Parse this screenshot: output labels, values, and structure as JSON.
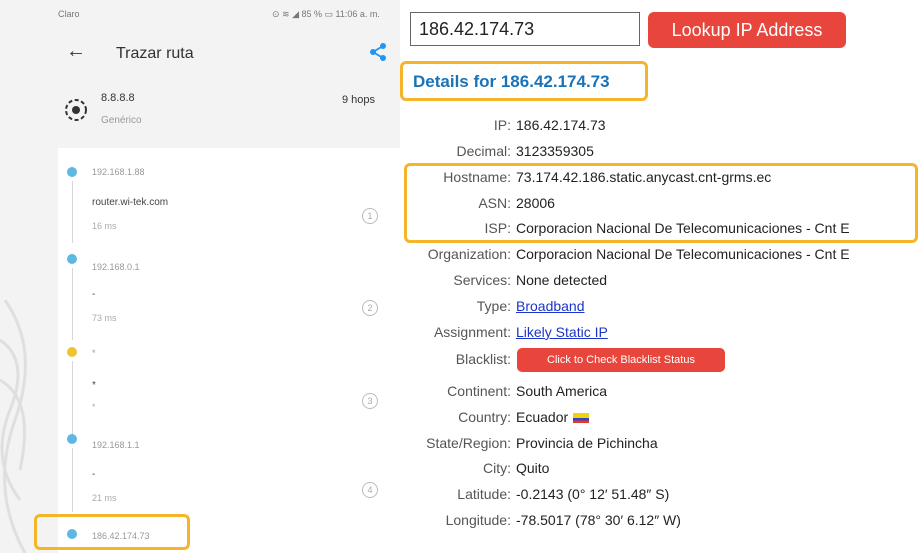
{
  "phone": {
    "status": {
      "carrier": "Claro",
      "right": "⊙ ≋ ◢ 85 % ▭ 11:06 a. m."
    },
    "title": "Trazar ruta",
    "target": {
      "host": "8.8.8.8",
      "sub": "Genérico",
      "hops": "9 hops"
    },
    "hops": [
      {
        "ip": "192.168.1.88",
        "name": "router.wi-tek.com",
        "ms": "16 ms",
        "num": "1",
        "color": "#5db8e2"
      },
      {
        "ip": "192.168.0.1",
        "name": "-",
        "ms": "73 ms",
        "num": "2",
        "color": "#5db8e2"
      },
      {
        "ip": "*",
        "name": "*",
        "ms": "*",
        "num": "3",
        "color": "#f1c232"
      },
      {
        "ip": "192.168.1.1",
        "name": "-",
        "ms": "21 ms",
        "num": "4",
        "color": "#5db8e2"
      },
      {
        "ip": "186.42.174.73",
        "color": "#5db8e2"
      }
    ]
  },
  "lookup": {
    "ip_value": "186.42.174.73",
    "button": "Lookup IP Address",
    "details_title": "Details for 186.42.174.73",
    "rows": [
      {
        "label": "IP:",
        "value": "186.42.174.73"
      },
      {
        "label": "Decimal:",
        "value": "3123359305"
      },
      {
        "label": "Hostname:",
        "value": "73.174.42.186.static.anycast.cnt-grms.ec"
      },
      {
        "label": "ASN:",
        "value": "28006"
      },
      {
        "label": "ISP:",
        "value": "Corporacion Nacional De Telecomunicaciones - Cnt E"
      },
      {
        "label": "Organization:",
        "value": "Corporacion Nacional De Telecomunicaciones - Cnt E"
      },
      {
        "label": "Services:",
        "value": "None detected"
      },
      {
        "label": "Type:",
        "value": "Broadband",
        "link": true
      },
      {
        "label": "Assignment:",
        "value": "Likely Static IP",
        "link": true
      },
      {
        "label": "Blacklist:",
        "button": "Click to Check Blacklist Status"
      },
      {
        "label": "Continent:",
        "value": "South America"
      },
      {
        "label": "Country:",
        "value": "Ecuador",
        "flag": true
      },
      {
        "label": "State/Region:",
        "value": "Provincia de Pichincha"
      },
      {
        "label": "City:",
        "value": "Quito"
      },
      {
        "label": "Latitude:",
        "value": "-0.2143  (0° 12′ 51.48″ S)"
      },
      {
        "label": "Longitude:",
        "value": "-78.5017  (78° 30′ 6.12″ W)"
      }
    ]
  },
  "colors": {
    "accent_red": "#e8453c",
    "link_blue": "#1a73b8",
    "highlight": "#f5b52b",
    "share_blue": "#2196f3"
  }
}
